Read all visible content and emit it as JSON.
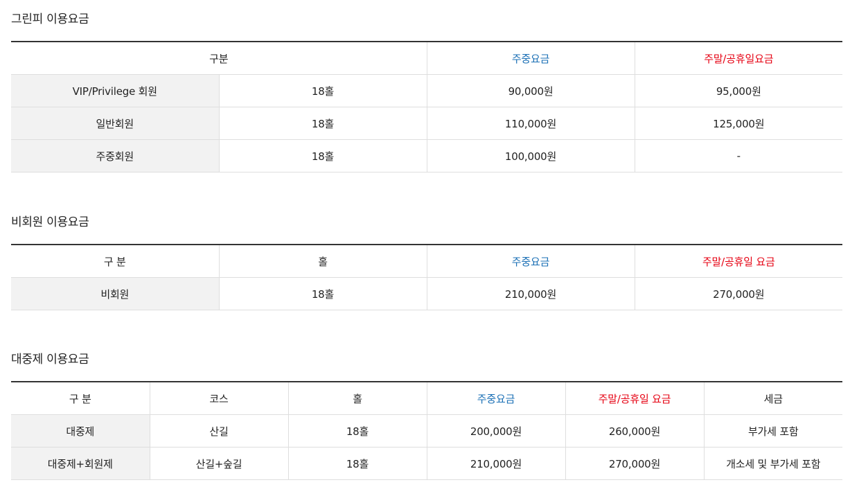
{
  "greenfee": {
    "title": "그린피 이용요금",
    "header": {
      "category": "구분",
      "weekday": "주중요금",
      "weekend": "주말/공휴일요금"
    },
    "rows": [
      {
        "member": "VIP/Privilege 회원",
        "holes": "18홀",
        "weekday": "90,000원",
        "weekend": "95,000원"
      },
      {
        "member": "일반회원",
        "holes": "18홀",
        "weekday": "110,000원",
        "weekend": "125,000원"
      },
      {
        "member": "주중회원",
        "holes": "18홀",
        "weekday": "100,000원",
        "weekend": "-"
      }
    ]
  },
  "nonmember": {
    "title": "비회원 이용요금",
    "header": {
      "category": "구 분",
      "holes": "홀",
      "weekday": "주중요금",
      "weekend": "주말/공휴일 요금"
    },
    "rows": [
      {
        "member": "비회원",
        "holes": "18홀",
        "weekday": "210,000원",
        "weekend": "270,000원"
      }
    ]
  },
  "public": {
    "title": "대중제 이용요금",
    "header": {
      "category": "구 분",
      "course": "코스",
      "holes": "홀",
      "weekday": "주중요금",
      "weekend": "주말/공휴일 요금",
      "tax": "세금"
    },
    "rows": [
      {
        "type": "대중제",
        "course": "산길",
        "holes": "18홀",
        "weekday": "200,000원",
        "weekend": "260,000원",
        "tax": "부가세 포함"
      },
      {
        "type": "대중제+회원제",
        "course": "산길+숲길",
        "holes": "18홀",
        "weekday": "210,000원",
        "weekend": "270,000원",
        "tax": "개소세 및 부가세 포함"
      }
    ]
  },
  "colors": {
    "weekday_header": "#1a6fb5",
    "weekend_header": "#e60012",
    "label_bg": "#f2f2f2"
  }
}
